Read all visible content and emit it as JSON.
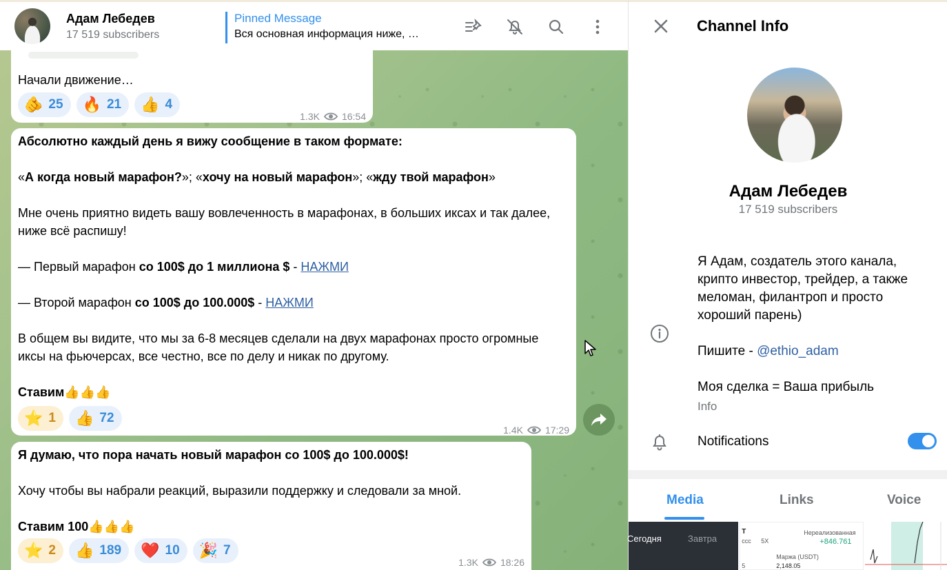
{
  "header": {
    "channel_name": "Адам Лебедев",
    "subscribers": "17 519 subscribers",
    "pinned_title": "Pinned Message",
    "pinned_text": "Вся основная информация ниже, …"
  },
  "messages": [
    {
      "text": "Начали движение…",
      "reactions": [
        {
          "emoji": "🫵",
          "count": "25"
        },
        {
          "emoji": "🔥",
          "count": "21"
        },
        {
          "emoji": "👍",
          "count": "4"
        }
      ],
      "views": "1.3K",
      "time": "16:54"
    },
    {
      "lines": {
        "l1": "Абсолютно каждый день я вижу сообщение в таком формате:",
        "l2a": "«",
        "l2b": "А когда новый марафон?",
        "l2c": "»; «",
        "l2d": "хочу на новый марафон",
        "l2e": "»; «",
        "l2f": "жду твой марафон",
        "l2g": "»",
        "l3": "Мне очень приятно видеть вашу вовлеченность в марафонах, в больших иксах и так далее, ниже всё распишу!",
        "l4a": "— Первый марафон ",
        "l4b": "со 100$ до 1 миллиона $",
        "l4c": " - ",
        "l4link": "НАЖМИ",
        "l5a": "— Второй марафон ",
        "l5b": "со 100$ до 100.000$",
        "l5c": " - ",
        "l5link": "НАЖМИ",
        "l6": "В общем вы видите, что мы за 6-8 месяцев сделали на двух марафонах просто огромные иксы на фьючерсах, все честно, все по делу и никак по другому.",
        "l7": "Ставим👍👍👍"
      },
      "reactions": [
        {
          "emoji": "⭐",
          "count": "1"
        },
        {
          "emoji": "👍",
          "count": "72"
        }
      ],
      "views": "1.4K",
      "time": "17:29"
    },
    {
      "lines": {
        "l1": "Я думаю, что пора начать новый марафон со 100$ до 100.000$!",
        "l2": "Хочу чтобы вы набрали реакций, выразили поддержку  и следовали за мной.",
        "l3": "Ставим 100👍👍👍"
      },
      "reactions": [
        {
          "emoji": "⭐",
          "count": "2"
        },
        {
          "emoji": "👍",
          "count": "189"
        },
        {
          "emoji": "❤️",
          "count": "10"
        },
        {
          "emoji": "🎉",
          "count": "7"
        }
      ],
      "views": "1.3K",
      "time": "18:26"
    }
  ],
  "info_panel": {
    "title": "Channel Info",
    "name": "Адам Лебедев",
    "subscribers": "17 519 subscribers",
    "about_1": "Я Адам, создатель этого канала, крипто инвестор, трейдер, а также меломан, филантроп и просто хороший парень)",
    "about_2_prefix": "Пишите - ",
    "about_2_mention": "@ethio_adam",
    "about_3": "Моя сделка = Ваша прибыль",
    "about_label": "Info",
    "notifications_label": "Notifications",
    "notifications_on": true,
    "tabs": [
      "Media",
      "Links",
      "Voice"
    ],
    "active_tab": "Media",
    "thumb_labels": {
      "today": "Сегодня",
      "tomorrow": "Завтра",
      "unrealized": "Нереализованная",
      "profit": "+846.761",
      "margin": "Маржа (USDT)",
      "margin_val": "2,148.05",
      "pair": "T",
      "cross": "ссс",
      "lev": "5X",
      "num": "5"
    }
  },
  "colors": {
    "accent": "#3390ec",
    "link": "#2e5fa3",
    "muted": "#707579"
  },
  "icons": [
    "pin-list-icon",
    "mute-bell-icon",
    "search-icon",
    "more-vertical-icon",
    "close-icon",
    "info-icon",
    "bell-icon",
    "eye-icon",
    "forward-icon"
  ]
}
